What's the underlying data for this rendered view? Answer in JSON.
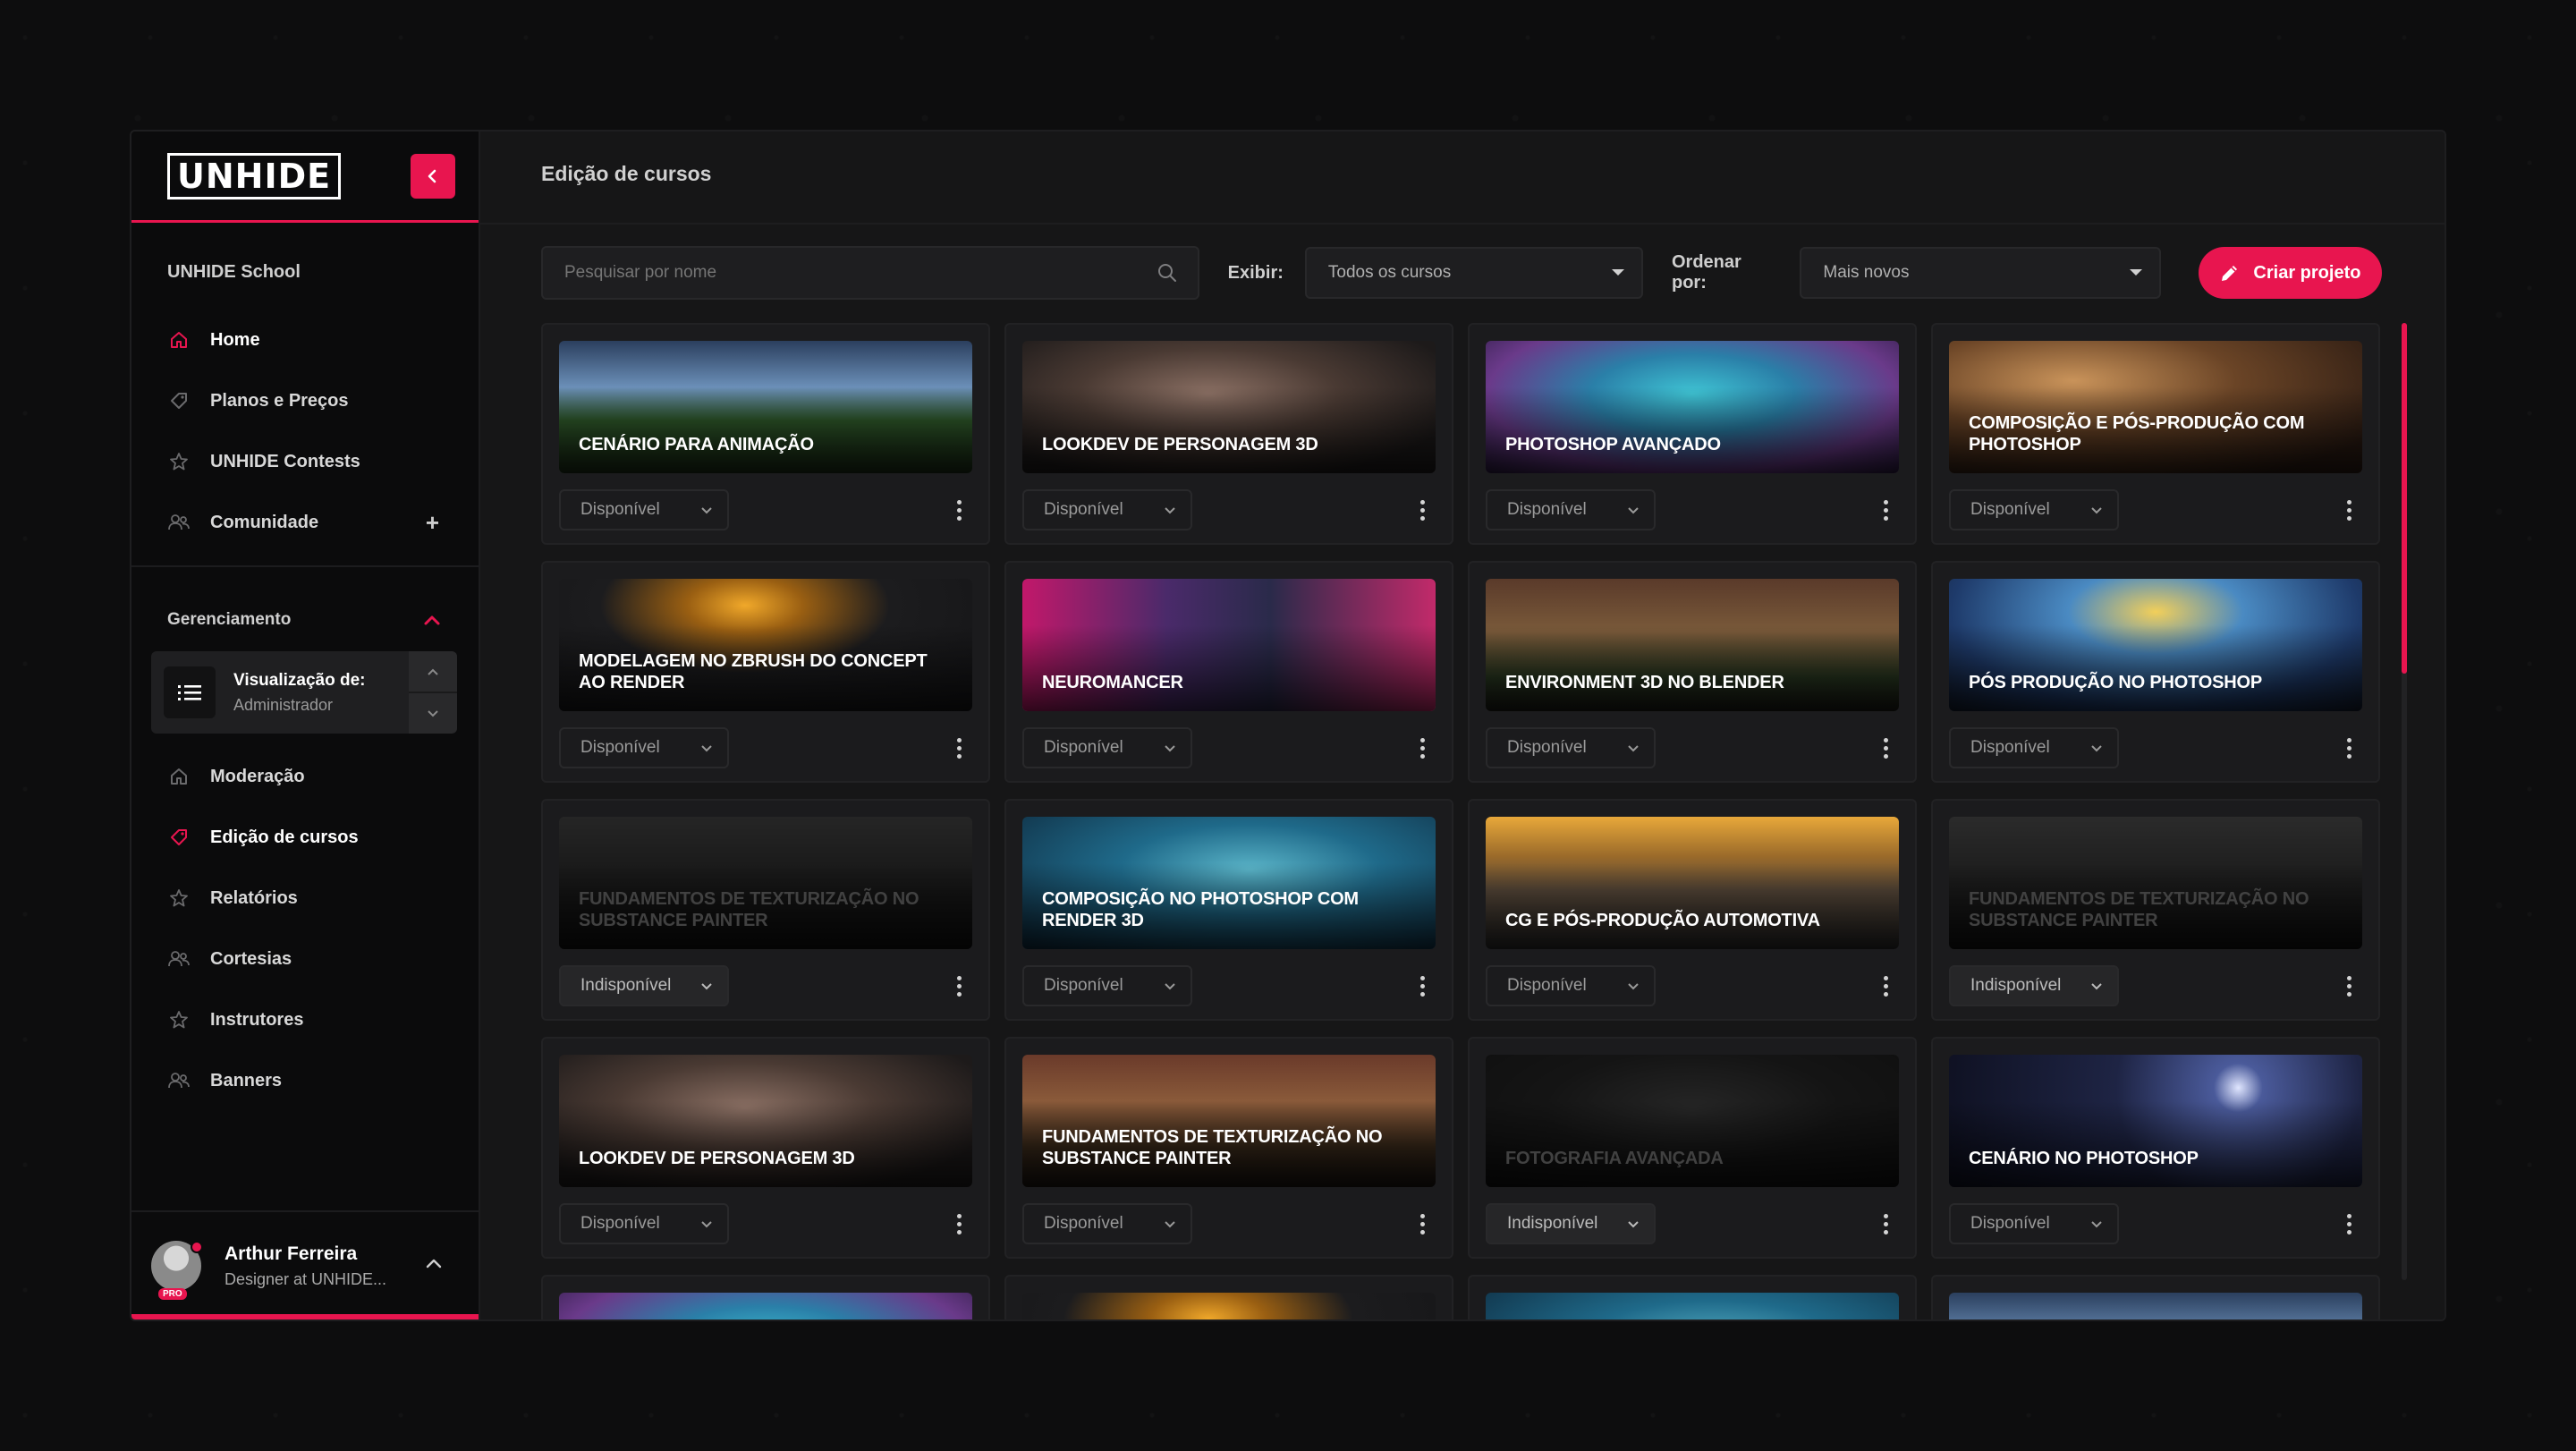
{
  "colors": {
    "accent": "#e8154f",
    "bg": "#0d0d0e",
    "panel": "#161617"
  },
  "sidebar": {
    "logo": "UNHIDE",
    "school": "UNHIDE School",
    "items": [
      {
        "label": "Home",
        "icon": "home-icon"
      },
      {
        "label": "Planos e Preços",
        "icon": "tag-icon"
      },
      {
        "label": "UNHIDE Contests",
        "icon": "star-icon"
      },
      {
        "label": "Comunidade",
        "icon": "users-icon"
      }
    ],
    "section": "Gerenciamento",
    "view": {
      "label": "Visualização de:",
      "role": "Administrador"
    },
    "manage_items": [
      {
        "label": "Moderação",
        "icon": "home-icon"
      },
      {
        "label": "Edição de cursos",
        "icon": "tag-icon"
      },
      {
        "label": "Relatórios",
        "icon": "star-icon"
      },
      {
        "label": "Cortesias",
        "icon": "users-icon"
      },
      {
        "label": "Instrutores",
        "icon": "star-icon"
      },
      {
        "label": "Banners",
        "icon": "users-icon"
      }
    ],
    "user": {
      "name": "Arthur Ferreira",
      "role": "Designer at UNHIDE...",
      "badge": "PRO"
    }
  },
  "main": {
    "title": "Edição de cursos",
    "search_placeholder": "Pesquisar por nome",
    "show_label": "Exibir:",
    "show_value": "Todos os cursos",
    "sort_label": "Ordenar por:",
    "sort_value": "Mais novos",
    "create_label": "Criar projeto"
  },
  "courses": [
    {
      "title": "CENÁRIO PARA ANIMAÇÃO",
      "status": "Disponível"
    },
    {
      "title": "LOOKDEV DE PERSONAGEM 3D",
      "status": "Disponível"
    },
    {
      "title": "PHOTOSHOP AVANÇADO",
      "status": "Disponível"
    },
    {
      "title": "COMPOSIÇÃO E PÓS-PRODUÇÃO COM PHOTOSHOP",
      "status": "Disponível"
    },
    {
      "title": "MODELAGEM NO ZBRUSH DO CONCEPT AO RENDER",
      "status": "Disponível"
    },
    {
      "title": "NEUROMANCER",
      "status": "Disponível"
    },
    {
      "title": "ENVIRONMENT 3D NO BLENDER",
      "status": "Disponível"
    },
    {
      "title": "PÓS PRODUÇÃO NO PHOTOSHOP",
      "status": "Disponível"
    },
    {
      "title": "FUNDAMENTOS DE TEXTURIZAÇÃO NO SUBSTANCE PAINTER",
      "status": "Indisponível"
    },
    {
      "title": "COMPOSIÇÃO NO PHOTOSHOP COM RENDER 3D",
      "status": "Disponível"
    },
    {
      "title": "CG E PÓS-PRODUÇÃO AUTOMOTIVA",
      "status": "Disponível"
    },
    {
      "title": "FUNDAMENTOS DE TEXTURIZAÇÃO NO SUBSTANCE PAINTER",
      "status": "Indisponível"
    },
    {
      "title": "LOOKDEV DE PERSONAGEM 3D",
      "status": "Disponível"
    },
    {
      "title": "FUNDAMENTOS DE TEXTURIZAÇÃO NO SUBSTANCE PAINTER",
      "status": "Disponível"
    },
    {
      "title": "FOTOGRAFIA AVANÇADA",
      "status": "Indisponível"
    },
    {
      "title": "CENÁRIO NO PHOTOSHOP",
      "status": "Disponível"
    }
  ]
}
